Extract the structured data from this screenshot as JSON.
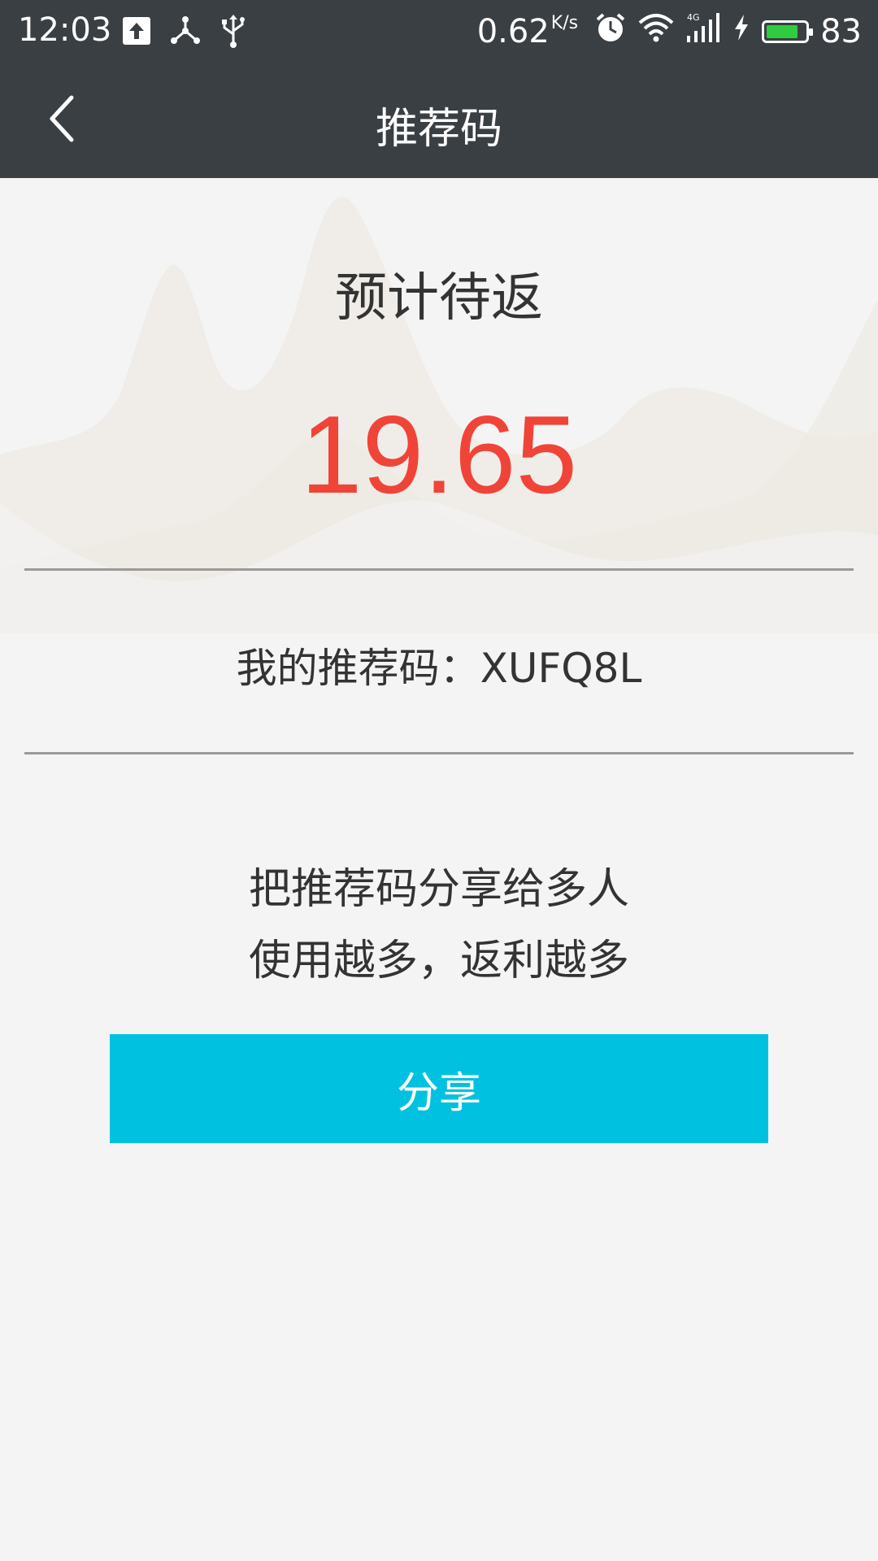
{
  "status_bar": {
    "time": "12:03",
    "net_speed": "0.62",
    "net_speed_unit": "K/s",
    "battery_level": "83",
    "icons": [
      "upload-icon",
      "share-nodes-icon",
      "usb-icon",
      "alarm-icon",
      "wifi-icon",
      "signal-4g-icon",
      "charging-icon",
      "battery-icon"
    ],
    "battery_color": "#2ecc40"
  },
  "nav": {
    "title": "推荐码",
    "back_icon": "chevron-left-icon"
  },
  "rebate": {
    "label": "预计待返",
    "amount": "19.65",
    "amount_color": "#f04438"
  },
  "referral": {
    "text": "我的推荐码：XUFQ8L"
  },
  "tips": {
    "line1": "把推荐码分享给多人",
    "line2": "使用越多，返利越多"
  },
  "share": {
    "label": "分享",
    "color": "#00c2e0"
  }
}
